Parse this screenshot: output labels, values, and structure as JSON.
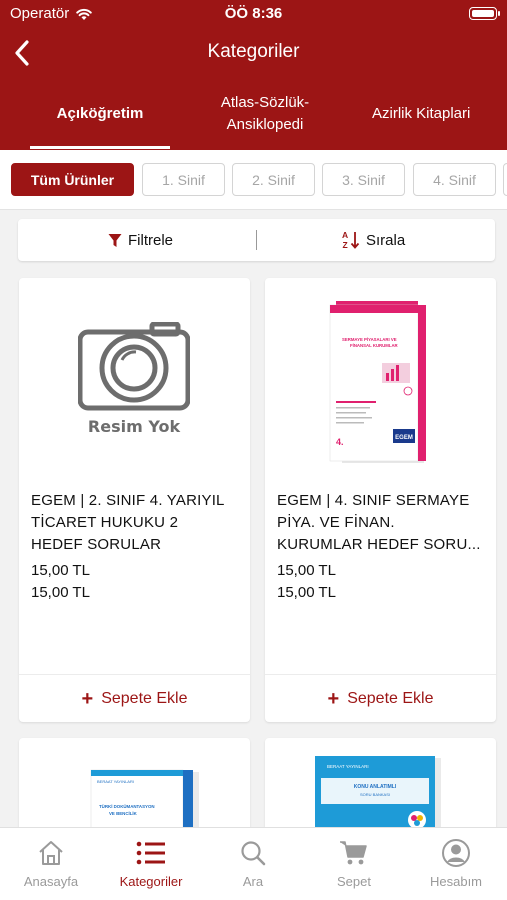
{
  "status": {
    "carrier": "Operatör",
    "time": "ÖÖ 8:36"
  },
  "header": {
    "title": "Kategoriler"
  },
  "tabs": [
    {
      "label": "Açıköğretim",
      "active": true
    },
    {
      "label": "Atlas-Sözlük-Ansiklopedi",
      "active": false
    },
    {
      "label": "Azirlik Kitaplari",
      "active": false
    }
  ],
  "chips": [
    "Tüm Ürünler",
    "1. Sinif",
    "2. Sinif",
    "3. Sinif",
    "4. Sinif"
  ],
  "toolbar": {
    "filter_label": "Filtrele",
    "sort_label": "Sırala"
  },
  "products": [
    {
      "placeholder_text": "Resim Yok",
      "name_lines": [
        "EGEM | 2. SINIF 4. YARIYIL",
        "TİCARET HUKUKU 2",
        "HEDEF SORULAR"
      ],
      "price": "15,00 TL",
      "price2": "15,00 TL",
      "add_label": "Sepete Ekle"
    },
    {
      "cover_title": "SERMAYE PİYASALARI VE FİNANSAL KURUMLAR",
      "cover_brand": "EGEM",
      "name_lines": [
        "EGEM | 4. SINIF SERMAYE",
        "PİYA. VE FİNAN.",
        "KURUMLAR HEDEF SORU..."
      ],
      "price": "15,00 TL",
      "price2": "15,00 TL",
      "add_label": "Sepete Ekle"
    },
    {
      "cover_title": "TÜRKİ DOKÜMANTASYON VE BENCİLİK"
    },
    {
      "cover_title": "KONU ANLATIMLI"
    }
  ],
  "bottom_nav": [
    {
      "label": "Anasayfa",
      "icon": "home-icon",
      "active": false
    },
    {
      "label": "Kategoriler",
      "icon": "list-icon",
      "active": true
    },
    {
      "label": "Ara",
      "icon": "search-icon",
      "active": false
    },
    {
      "label": "Sepet",
      "icon": "cart-icon",
      "active": false
    },
    {
      "label": "Hesabım",
      "icon": "user-icon",
      "active": false
    }
  ],
  "colors": {
    "brand": "#9c1515",
    "inactive": "#9a9a9a",
    "pink_cover": "#e0206e",
    "blue_cover": "#1e9bd7"
  }
}
